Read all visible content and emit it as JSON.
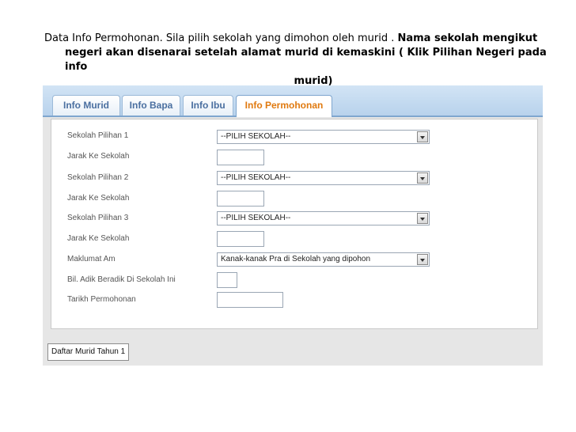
{
  "caption": {
    "normal": "Data Info Permohonan. Sila pilih sekolah yang dimohon oleh murid .",
    "bold_1": "Nama sekolah mengikut",
    "bold_2": "negeri akan disenarai setelah alamat murid di kemaskini ( Klik Pilihan Negeri pada info",
    "bold_3": "murid)"
  },
  "tabs": [
    {
      "label": "Info Murid"
    },
    {
      "label": "Info Bapa"
    },
    {
      "label": "Info Ibu"
    },
    {
      "label": "Info Permohonan",
      "active": true
    }
  ],
  "form": {
    "sekolah1": {
      "label": "Sekolah Pilihan 1",
      "value": "--PILIH SEKOLAH--"
    },
    "jarak1": {
      "label": "Jarak Ke Sekolah"
    },
    "sekolah2": {
      "label": "Sekolah Pilihan 2",
      "value": "--PILIH SEKOLAH--"
    },
    "jarak2": {
      "label": "Jarak Ke Sekolah"
    },
    "sekolah3": {
      "label": "Sekolah Pilihan 3",
      "value": "--PILIH SEKOLAH--"
    },
    "jarak3": {
      "label": "Jarak Ke Sekolah"
    },
    "maklumat": {
      "label": "Maklumat Am",
      "value": "Kanak-kanak Pra di Sekolah yang dipohon"
    },
    "adik": {
      "label": "Bil. Adik Beradik Di Sekolah Ini"
    },
    "tarikh": {
      "label": "Tarikh Permohonan"
    }
  },
  "footer": {
    "button_label": "Daftar Murid Tahun 1"
  },
  "colors": {
    "tab_active_text": "#e07a10",
    "tab_text": "#4a6fa0",
    "tabbar": "#b8d2ec"
  }
}
